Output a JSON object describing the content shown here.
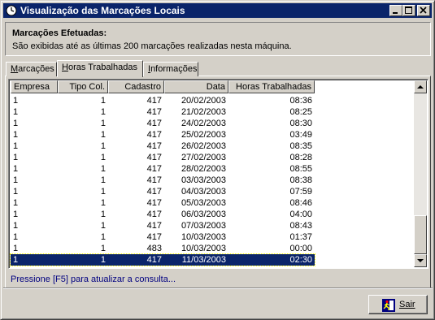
{
  "window": {
    "title": "Visualização das Marcações Locais",
    "controls": [
      "minimize",
      "maximize",
      "close"
    ]
  },
  "header": {
    "title": "Marcações Efetuadas:",
    "subtitle": "São exibidas até as últimas 200 marcações realizadas nesta máquina."
  },
  "tabs": [
    {
      "label": "Marcações",
      "active": false
    },
    {
      "label": "Horas Trabalhadas",
      "active": true
    },
    {
      "label": "Informações",
      "active": false
    }
  ],
  "table": {
    "columns": [
      "Empresa",
      "Tipo Col.",
      "Cadastro",
      "Data",
      "Horas Trabalhadas"
    ],
    "rows": [
      [
        "1",
        "1",
        "417",
        "20/02/2003",
        "08:36"
      ],
      [
        "1",
        "1",
        "417",
        "21/02/2003",
        "08:25"
      ],
      [
        "1",
        "1",
        "417",
        "24/02/2003",
        "08:30"
      ],
      [
        "1",
        "1",
        "417",
        "25/02/2003",
        "03:49"
      ],
      [
        "1",
        "1",
        "417",
        "26/02/2003",
        "08:35"
      ],
      [
        "1",
        "1",
        "417",
        "27/02/2003",
        "08:28"
      ],
      [
        "1",
        "1",
        "417",
        "28/02/2003",
        "08:55"
      ],
      [
        "1",
        "1",
        "417",
        "03/03/2003",
        "08:38"
      ],
      [
        "1",
        "1",
        "417",
        "04/03/2003",
        "07:59"
      ],
      [
        "1",
        "1",
        "417",
        "05/03/2003",
        "08:46"
      ],
      [
        "1",
        "1",
        "417",
        "06/03/2003",
        "04:00"
      ],
      [
        "1",
        "1",
        "417",
        "07/03/2003",
        "08:43"
      ],
      [
        "1",
        "1",
        "417",
        "10/03/2003",
        "01:37"
      ],
      [
        "1",
        "1",
        "483",
        "10/03/2003",
        "00:00"
      ],
      [
        "1",
        "1",
        "417",
        "11/03/2003",
        "02:30"
      ]
    ],
    "selected_row": 14
  },
  "status_text": "Pressione [F5] para atualizar a consulta...",
  "buttons": {
    "exit_label": "Sair",
    "exit_icon": "exit-runner-icon"
  },
  "colors": {
    "titlebar": "#0a246a",
    "selection": "#0a246a",
    "status_text": "#000080",
    "face": "#d4d0c8"
  }
}
